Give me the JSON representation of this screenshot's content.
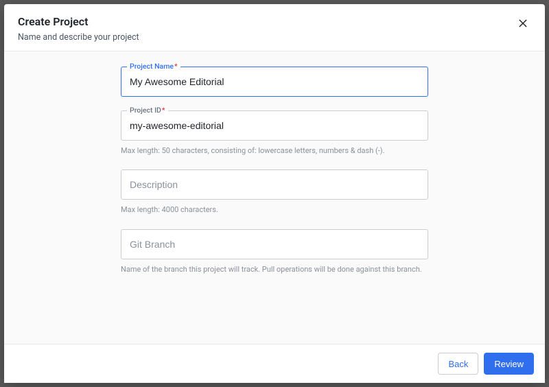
{
  "modal": {
    "title": "Create Project",
    "subtitle": "Name and describe your project"
  },
  "form": {
    "project_name": {
      "label": "Project Name",
      "required_mark": "*",
      "value": "My Awesome Editorial"
    },
    "project_id": {
      "label": "Project ID",
      "required_mark": "*",
      "value": "my-awesome-editorial",
      "helper": "Max length: 50 characters, consisting of: lowercase letters, numbers & dash (-)."
    },
    "description": {
      "placeholder": "Description",
      "helper": "Max length: 4000 characters."
    },
    "git_branch": {
      "placeholder": "Git Branch",
      "helper": "Name of the branch this project will track. Pull operations will be done against this branch."
    }
  },
  "footer": {
    "back_label": "Back",
    "review_label": "Review"
  }
}
